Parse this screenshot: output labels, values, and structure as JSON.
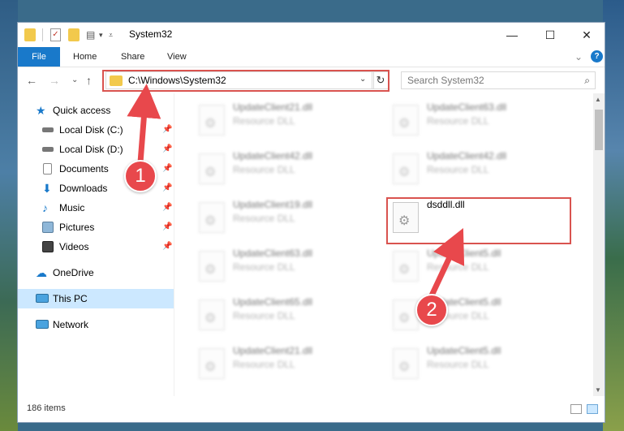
{
  "window": {
    "title": "System32",
    "accent": "#1979ca"
  },
  "titlebar": {
    "quick_access_icons": [
      "folder-icon",
      "properties-icon",
      "new-folder-icon",
      "view-options-icon"
    ],
    "controls": {
      "minimize": "—",
      "maximize": "☐",
      "close": "✕"
    }
  },
  "ribbon": {
    "tabs": [
      {
        "label": "File"
      },
      {
        "label": "Home"
      },
      {
        "label": "Share"
      },
      {
        "label": "View"
      }
    ],
    "expand": "⌄",
    "help": "?"
  },
  "nav": {
    "back": "←",
    "forward": "→",
    "recent": "⌄",
    "up": "↑",
    "address": "C:\\Windows\\System32",
    "refresh": "↻",
    "search_placeholder": "Search System32",
    "search_icon": "⌕"
  },
  "sidebar": {
    "items": [
      {
        "label": "Quick access",
        "icon": "star-icon",
        "pinned": false
      },
      {
        "label": "Local Disk (C:)",
        "icon": "drive-icon",
        "pinned": true
      },
      {
        "label": "Local Disk (D:)",
        "icon": "drive-icon",
        "pinned": true
      },
      {
        "label": "Documents",
        "icon": "documents-icon",
        "pinned": true
      },
      {
        "label": "Downloads",
        "icon": "downloads-icon",
        "pinned": true
      },
      {
        "label": "Music",
        "icon": "music-icon",
        "pinned": true
      },
      {
        "label": "Pictures",
        "icon": "pictures-icon",
        "pinned": true
      },
      {
        "label": "Videos",
        "icon": "videos-icon",
        "pinned": true
      },
      {
        "label": "OneDrive",
        "icon": "cloud-icon",
        "pinned": false
      },
      {
        "label": "This PC",
        "icon": "computer-icon",
        "pinned": false,
        "selected": true
      },
      {
        "label": "Network",
        "icon": "network-icon",
        "pinned": false
      }
    ],
    "pin_glyph": "📌"
  },
  "files": {
    "left_column": [
      {
        "name": "UpdateClient21.dll",
        "type": "Resource DLL"
      },
      {
        "name": "UpdateClient42.dll",
        "type": "Resource DLL"
      },
      {
        "name": "UpdateClient19.dll",
        "type": "Resource DLL"
      },
      {
        "name": "UpdateClient63.dll",
        "type": "Resource DLL"
      },
      {
        "name": "UpdateClient65.dll",
        "type": "Resource DLL"
      },
      {
        "name": "UpdateClient21.dll",
        "type": "Resource DLL"
      }
    ],
    "right_column": [
      {
        "name": "UpdateClient63.dll",
        "type": "Resource DLL"
      },
      {
        "name": "UpdateClient42.dll",
        "type": "Resource DLL"
      },
      {
        "name": "dsddll.dll",
        "type": ""
      },
      {
        "name": "UpdateClient5.dll",
        "type": "Resource DLL"
      },
      {
        "name": "UpdateClient5.dll",
        "type": "Resource DLL"
      },
      {
        "name": "UpdateClient5.dll",
        "type": "Resource DLL"
      }
    ]
  },
  "status": {
    "item_count": "186 items"
  },
  "annotations": {
    "badge1": "1",
    "badge2": "2",
    "color": "#d9534f"
  }
}
